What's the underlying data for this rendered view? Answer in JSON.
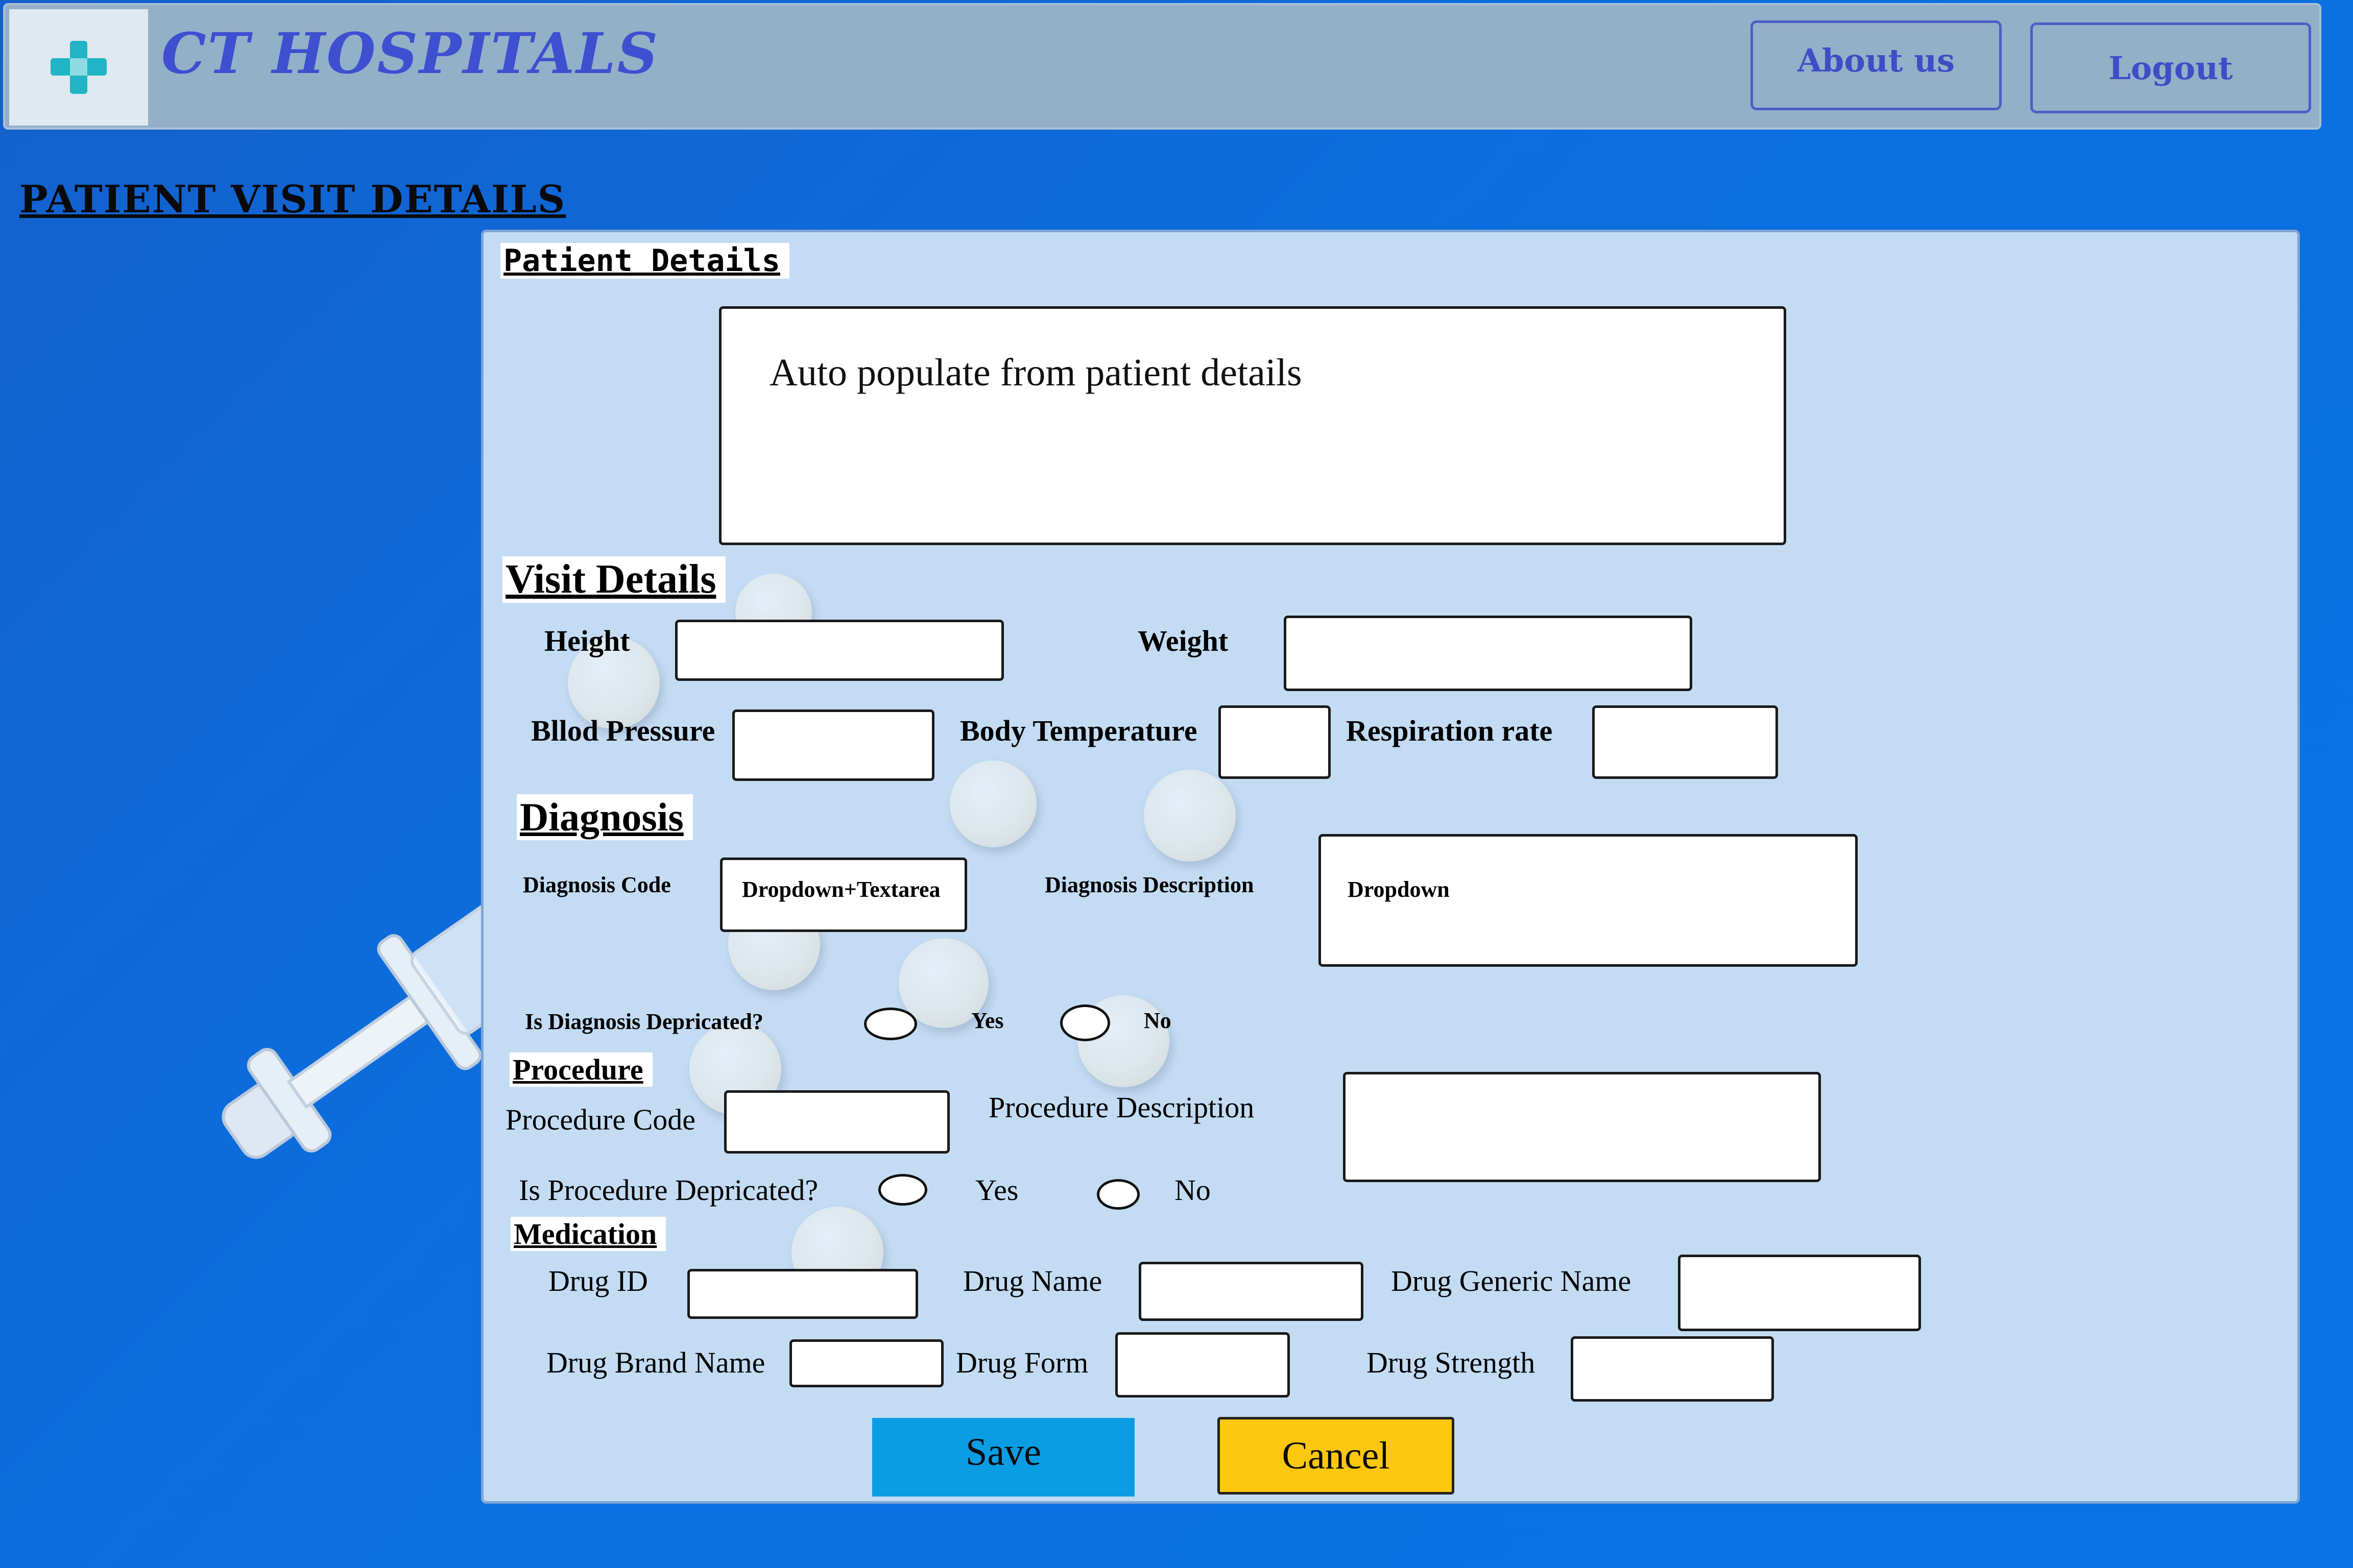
{
  "header": {
    "brand": "CT HOSPITALS",
    "logo_icon": "medical-cross-icon",
    "about_label": "About us",
    "logout_label": "Logout"
  },
  "page_title": "PATIENT VISIT DETAILS",
  "patient_details": {
    "label": "Patient Details",
    "text": "Auto populate from patient details"
  },
  "visit_details": {
    "label": "Visit Details",
    "height": "Height",
    "weight": "Weight",
    "blood_pressure": "Bllod Pressure",
    "body_temperature": "Body Temperature",
    "respiration_rate": "Respiration rate"
  },
  "diagnosis": {
    "label": "Diagnosis",
    "code": "Diagnosis Code",
    "code_field": "Dropdown+Textarea",
    "description": "Diagnosis Description",
    "description_field": "Dropdown",
    "deprecated": "Is Diagnosis Depricated?",
    "yes": "Yes",
    "no": "No"
  },
  "procedure": {
    "label": "Procedure",
    "code": "Procedure Code",
    "description": "Procedure Description",
    "deprecated": "Is Procedure Depricated?",
    "yes": "Yes",
    "no": "No"
  },
  "medication": {
    "label": "Medication",
    "drug_id": "Drug ID",
    "drug_name": "Drug Name",
    "drug_generic_name": "Drug Generic Name",
    "drug_brand_name": "Drug Brand Name",
    "drug_form": "Drug Form",
    "drug_strength": "Drug Strength"
  },
  "actions": {
    "save": "Save",
    "cancel": "Cancel"
  },
  "colors": {
    "background": "#0b6fe0",
    "header": "#94afc8",
    "brand": "#3e4fd0",
    "panel": "#c3dcf3",
    "save": "#0a9de3",
    "cancel": "#fec70f"
  }
}
